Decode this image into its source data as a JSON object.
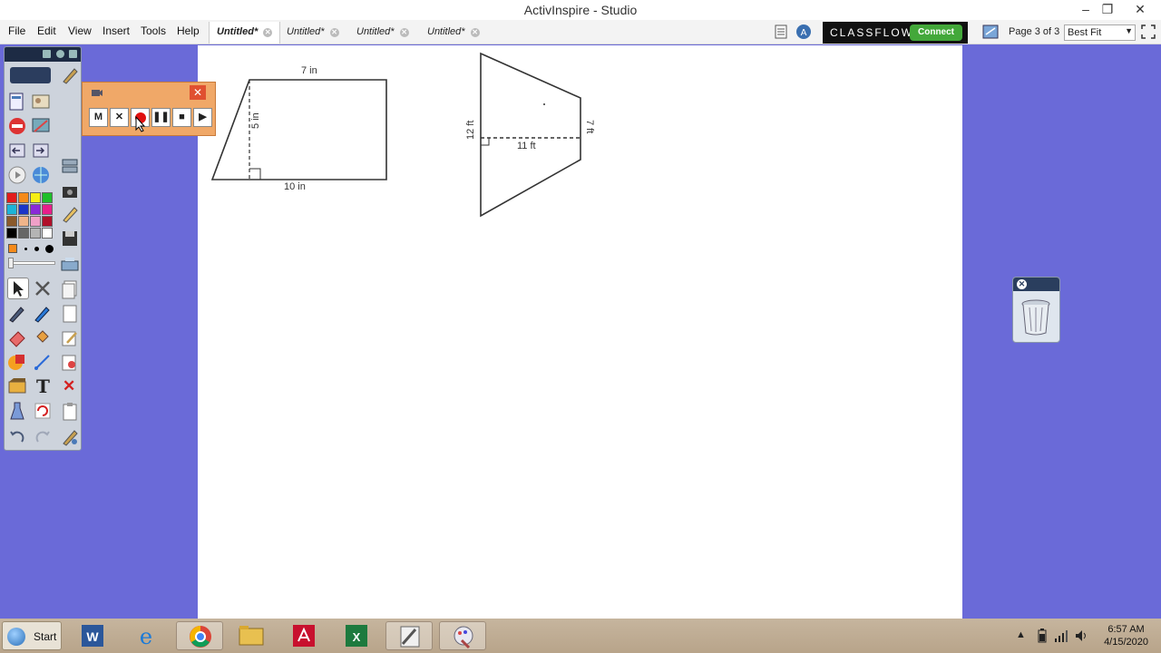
{
  "window": {
    "title": "ActivInspire - Studio"
  },
  "menu": [
    "File",
    "Edit",
    "View",
    "Insert",
    "Tools",
    "Help"
  ],
  "tabs": [
    {
      "label": "Untitled*",
      "active": true
    },
    {
      "label": "Untitled*",
      "active": false
    },
    {
      "label": "Untitled*",
      "active": false
    },
    {
      "label": "Untitled*",
      "active": false
    }
  ],
  "classflow": {
    "label": "CLASSFLOW",
    "connect": "Connect"
  },
  "page": {
    "indicator": "Page 3 of 3",
    "zoom": "Best Fit"
  },
  "recorder": {
    "buttons": [
      "M",
      "✕",
      "",
      "❚❚",
      "■",
      "▶"
    ]
  },
  "figure1": {
    "top": "7 in",
    "height": "5 in",
    "bottom": "10 in"
  },
  "figure2": {
    "left": "12 ft",
    "right": "7 ft",
    "width": "11 ft"
  },
  "taskbar": {
    "start": "Start",
    "time": "6:57 AM",
    "date": "4/15/2020"
  },
  "colors": {
    "desktop": "#6a6ad8",
    "recorder": "#f0a868",
    "classflow_button": "#43a83a"
  }
}
